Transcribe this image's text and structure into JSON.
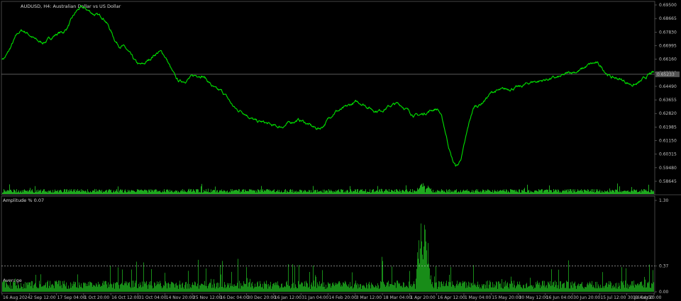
{
  "window": {
    "title": "AUDUSD, H4:  Australian Dollar vs US Dollar",
    "sub_title": "Amplitude % 0.07",
    "average_label": "Average",
    "current_price": "0.65233"
  },
  "colors": {
    "background": "#000000",
    "price_line": "#00e000",
    "histogram": "#1faa1f",
    "grid_line": "#777777",
    "average_line": "#c8c8c8"
  },
  "icons": [
    "chart-window-icon",
    "indicator-window-icon"
  ],
  "chart_data": [
    {
      "type": "line",
      "title": "AUDUSD, H4:  Australian Dollar vs US Dollar",
      "ylim": [
        0.58645,
        0.695
      ],
      "y_ticks": [
        "0.69500",
        "0.68665",
        "0.67830",
        "0.66995",
        "0.66160",
        "0.65325",
        "0.64490",
        "0.63655",
        "0.62820",
        "0.61985",
        "0.61150",
        "0.60315",
        "0.59480",
        "0.58645"
      ],
      "current_price_line": 0.65233,
      "x_start": "16 Aug 2024",
      "x_end": "13 Aug 20:00",
      "key_points": [
        [
          "16 Aug 2024",
          0.662
        ],
        [
          "2 Sep 12:00",
          0.679
        ],
        [
          "12 Sep",
          0.672
        ],
        [
          "17 Sep 04:00",
          0.678
        ],
        [
          "30 Sep",
          0.693
        ],
        [
          "1 Oct 20:00",
          0.688
        ],
        [
          "16 Oct 12:00",
          0.67
        ],
        [
          "31 Oct 04:00",
          0.658
        ],
        [
          "4 Nov",
          0.666
        ],
        [
          "14 Nov 20:00",
          0.648
        ],
        [
          "25 Nov 12:00",
          0.652
        ],
        [
          "4 Dec",
          0.642
        ],
        [
          "16 Dec 04:00",
          0.63
        ],
        [
          "25 Dec",
          0.623
        ],
        [
          "30 Dec 20:00",
          0.62
        ],
        [
          "16 Jan 12:00",
          0.624
        ],
        [
          "31 Jan 04:00",
          0.619
        ],
        [
          "10 Feb",
          0.63
        ],
        [
          "14 Feb 20:00",
          0.635
        ],
        [
          "3 Mar 12:00",
          0.63
        ],
        [
          "18 Mar 04:00",
          0.634
        ],
        [
          "30 Mar",
          0.627
        ],
        [
          "1 Apr 20:00",
          0.631
        ],
        [
          "9 Apr",
          0.596
        ],
        [
          "16 Apr 12:00",
          0.633
        ],
        [
          "1 May 04:00",
          0.642
        ],
        [
          "15 May 20:00",
          0.644
        ],
        [
          "30 May 12:00",
          0.648
        ],
        [
          "16 Jun 04:00",
          0.65
        ],
        [
          "30 Jun 20:00",
          0.654
        ],
        [
          "15 Jul 12:00",
          0.659
        ],
        [
          "22 Jul",
          0.65
        ],
        [
          "30 Jul 04:00",
          0.646
        ],
        [
          "13 Aug 20:00",
          0.653
        ]
      ]
    },
    {
      "type": "bar",
      "title": "Amplitude % 0.07",
      "ylim": [
        0.0,
        1.3
      ],
      "y_ticks": [
        "1.30",
        "0.37",
        "0.00"
      ],
      "average": 0.37,
      "spike_region": [
        "1 Apr 20:00",
        "16 Apr 12:00"
      ],
      "spike_peak": 1.28
    }
  ],
  "x_axis": {
    "labels": [
      "16 Aug 2024",
      "2 Sep 12:00",
      "17 Sep 04:00",
      "1 Oct 20:00",
      "16 Oct 12:00",
      "31 Oct 04:00",
      "14 Nov 20:00",
      "25 Nov 12:00",
      "16 Dec 04:00",
      "30 Dec 20:00",
      "16 Jan 12:00",
      "31 Jan 04:00",
      "14 Feb 20:00",
      "3 Mar 12:00",
      "18 Mar 04:00",
      "1 Apr 20:00",
      "16 Apr 12:00",
      "1 May 04:00",
      "15 May 20:00",
      "30 May 12:00",
      "16 Jun 04:00",
      "30 Jun 20:00",
      "15 Jul 12:00",
      "30 Jul 04:00",
      "13 Aug 20:00"
    ]
  }
}
